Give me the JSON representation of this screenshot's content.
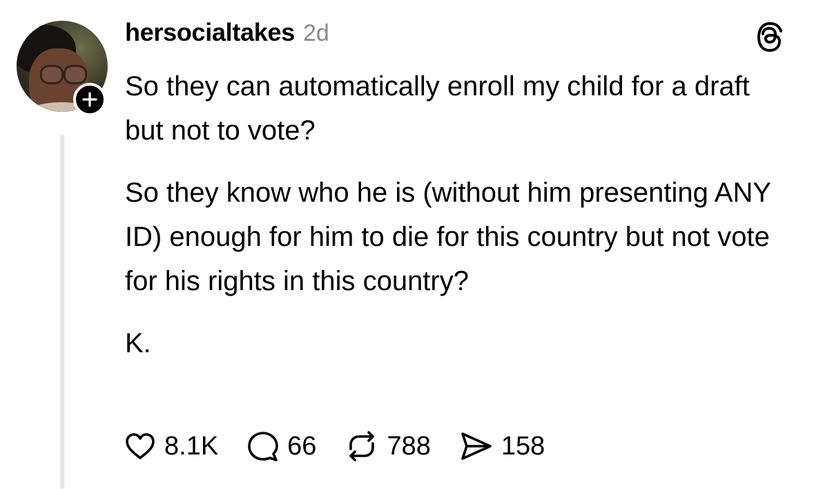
{
  "post": {
    "username": "hersocialtakes",
    "timestamp": "2d",
    "paragraphs": [
      "So they can automatically enroll my child for a draft but not to vote?",
      "So they know who he is (without him presenting ANY ID) enough for him to die for this country but not vote for his rights in this country?",
      "K."
    ]
  },
  "actions": {
    "likes": "8.1K",
    "replies": "66",
    "reposts": "788",
    "shares": "158"
  },
  "icons": {
    "follow": "plus-icon",
    "brand": "threads-logo-icon",
    "like": "heart-icon",
    "reply": "comment-bubble-icon",
    "repost": "repost-icon",
    "share": "send-icon"
  }
}
